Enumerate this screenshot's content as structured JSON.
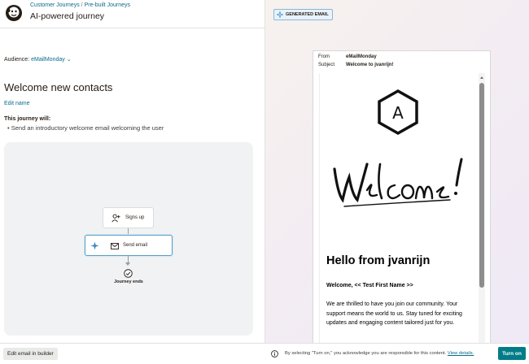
{
  "header": {
    "breadcrumb": [
      "Customer Journeys",
      "Pre-built Journeys"
    ],
    "breadcrumb_sep": "/",
    "title": "AI-powered journey",
    "logo_icon": "mailchimp-logo"
  },
  "audience": {
    "label": "Audience:",
    "value": "eMailMonday"
  },
  "journey": {
    "name": "Welcome new contacts",
    "edit_name_label": "Edit name",
    "will_label": "This journey will:",
    "bullets": [
      "Send an introductory welcome email welcoming the user"
    ]
  },
  "flow": {
    "trigger_label": "Signs up",
    "action_label": "Send email",
    "end_label": "Journey ends"
  },
  "preview": {
    "badge": "GENERATED EMAIL",
    "from_key": "From",
    "from_value": "eMailMonday",
    "subject_key": "Subject",
    "subject_value": "Welcome to jvanrijn!",
    "logo_letter": "A",
    "heading": "Hello from jvanrijn",
    "greeting": "Welcome, << Test First Name >>",
    "paragraph": "We are thrilled to have you join our community. Your support means the world to us. Stay tuned for exciting updates and engaging content tailored just for you."
  },
  "footer": {
    "edit_builder_label": "Edit email in builder",
    "disclaimer_text": "By selecting \"Turn on,\" you acknowledge you are responsible for this content.",
    "view_details_label": "View details.",
    "turn_on_label": "Turn on"
  },
  "colors": {
    "accent": "#007c89",
    "link": "#0a6b8a",
    "text": "#241c15"
  }
}
